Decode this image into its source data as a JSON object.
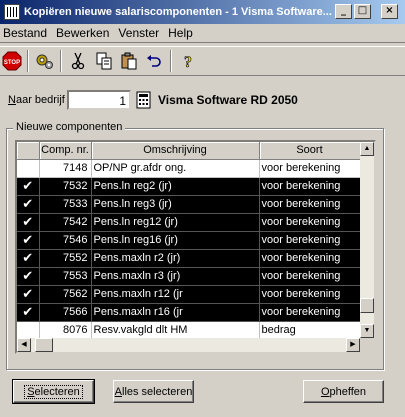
{
  "window": {
    "title": "Kopiëren nieuwe salariscomponenten - 1 Visma Software...",
    "minimize": "_",
    "maximize": "□",
    "close": "×"
  },
  "menu": [
    "Bestand",
    "Bewerken",
    "Venster",
    "Help"
  ],
  "toolbar": {
    "stop_label": "STOP",
    "help_label": "?"
  },
  "company": {
    "label_prefix": "",
    "label_accel": "N",
    "label_rest": "aar bedrijf",
    "value": "1",
    "name": "Visma Software RD 2050"
  },
  "group": {
    "title": "Nieuwe componenten"
  },
  "table": {
    "headers": [
      "",
      "Comp. nr.",
      "Omschrijving",
      "Soort"
    ],
    "rows": [
      {
        "check": "",
        "nr": "7148",
        "desc": "OP/NP gr.afdr ong.",
        "soort": "voor berekening",
        "selected": false
      },
      {
        "check": "✔",
        "nr": "7532",
        "desc": "Pens.ln reg2 (jr)",
        "soort": "voor berekening",
        "selected": true
      },
      {
        "check": "✔",
        "nr": "7533",
        "desc": "Pens.ln reg3 (jr)",
        "soort": "voor berekening",
        "selected": true
      },
      {
        "check": "✔",
        "nr": "7542",
        "desc": "Pens.ln reg12 (jr)",
        "soort": "voor berekening",
        "selected": true
      },
      {
        "check": "✔",
        "nr": "7546",
        "desc": "Pens.ln reg16 (jr)",
        "soort": "voor berekening",
        "selected": true
      },
      {
        "check": "✔",
        "nr": "7552",
        "desc": "Pens.maxln r2 (jr)",
        "soort": "voor berekening",
        "selected": true
      },
      {
        "check": "✔",
        "nr": "7553",
        "desc": "Pens.maxln r3 (jr)",
        "soort": "voor berekening",
        "selected": true
      },
      {
        "check": "✔",
        "nr": "7562",
        "desc": "Pens.maxln r12 (jr",
        "soort": "voor berekening",
        "selected": true
      },
      {
        "check": "✔",
        "nr": "7566",
        "desc": "Pens.maxln r16 (jr",
        "soort": "voor berekening",
        "selected": true
      },
      {
        "check": "",
        "nr": "8076",
        "desc": "Resv.vakgld dlt HM",
        "soort": "bedrag",
        "selected": false
      }
    ]
  },
  "buttons": {
    "select_accel": "S",
    "select_rest": "electeren",
    "select_all_accel": "A",
    "select_all_rest": "lles selecteren",
    "cancel_accel": "O",
    "cancel_rest": "pheffen"
  },
  "colors": {
    "titlebar_start": "#0a246a",
    "titlebar_end": "#a6caf0",
    "face": "#d4d0c8",
    "selected_row": "#000000"
  }
}
